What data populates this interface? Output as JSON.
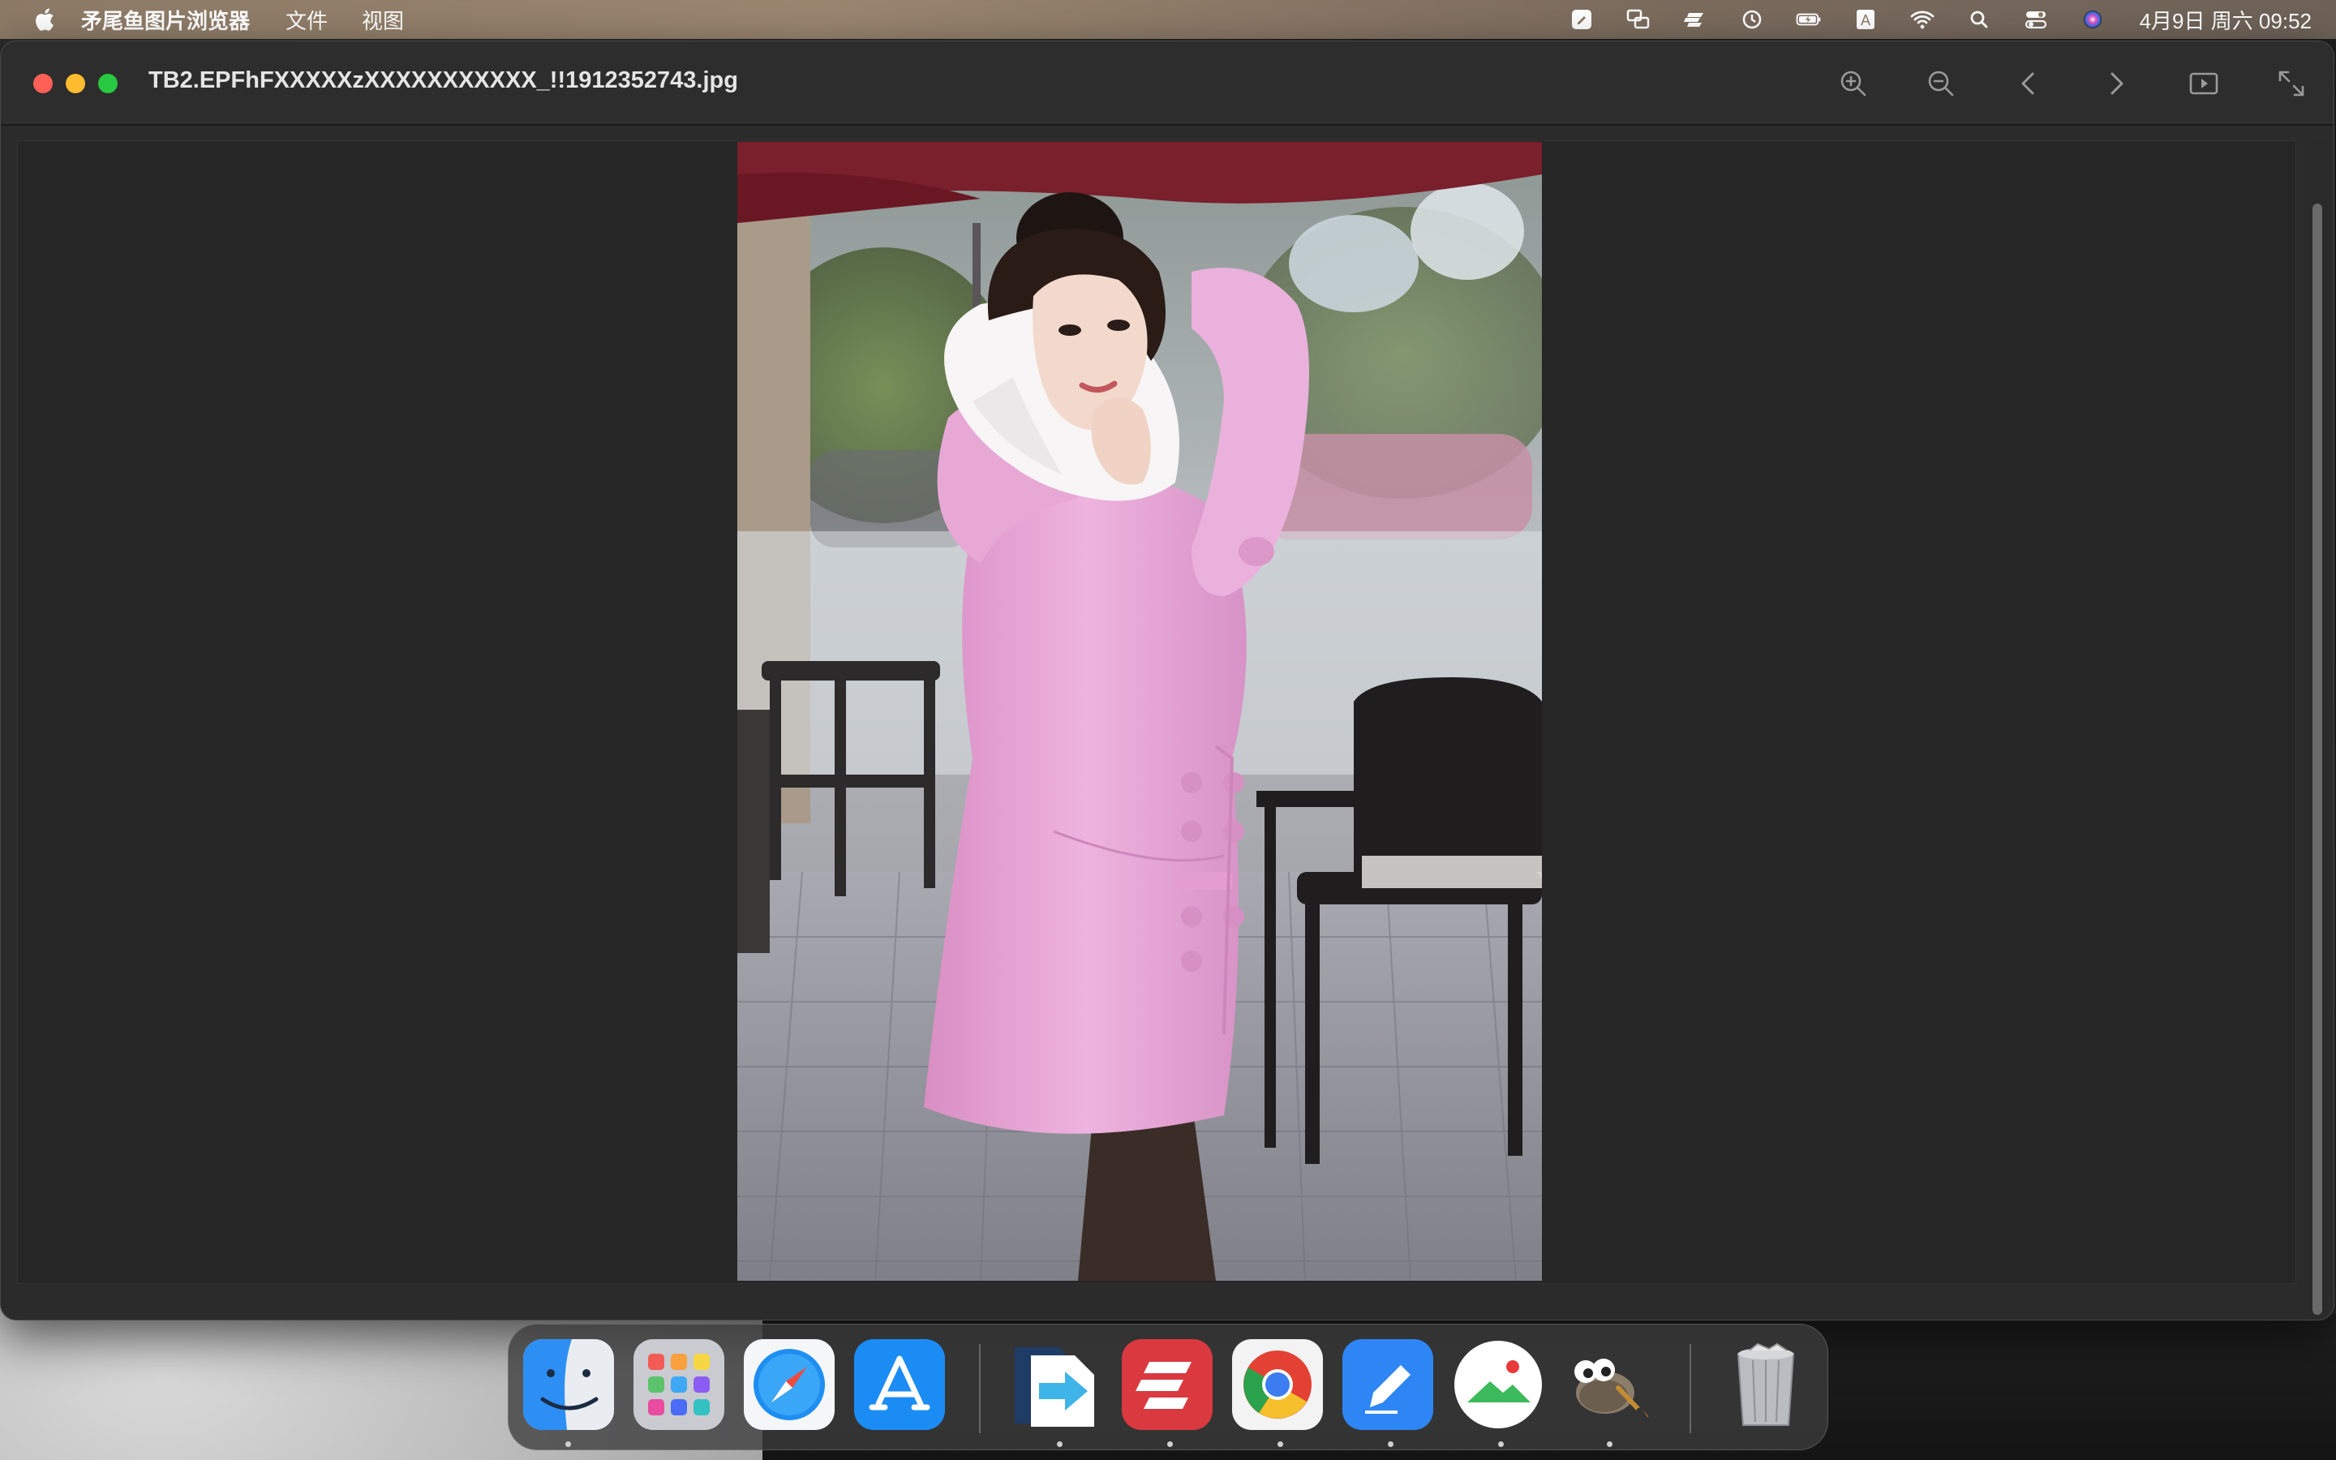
{
  "menubar": {
    "app_name": "矛尾鱼图片浏览器",
    "menus": [
      "文件",
      "视图"
    ],
    "status_icons": [
      "note-icon",
      "screen-mirror-icon",
      "expressvpn-icon",
      "time-machine-icon",
      "battery-icon",
      "input-method-icon",
      "wifi-icon",
      "spotlight-search-icon",
      "control-center-icon",
      "siri-icon"
    ],
    "input_method_label": "A",
    "clock": "4月9日 周六  09:52"
  },
  "window": {
    "title": "TB2.EPFhFXXXXXzXXXXXXXXXXX_!!1912352743.jpg",
    "toolbar": [
      "zoom-in-icon",
      "zoom-out-icon",
      "previous-icon",
      "next-icon",
      "slideshow-icon",
      "fullscreen-icon"
    ]
  },
  "photo": {
    "description_icon": "photo-woman-pink-coat",
    "colors": {
      "coat": "#e9a9d6",
      "umbrella": "#7a1f2c",
      "ground": "#8d8e96"
    }
  },
  "dock": {
    "apps": [
      "finder-icon",
      "launchpad-icon",
      "safari-icon",
      "app-store-icon",
      "migrate-icon",
      "expressvpn-icon",
      "chrome-icon",
      "pages-icon",
      "preview-icon",
      "gimp-icon",
      "trash-icon"
    ]
  },
  "colors": {
    "close": "#fe5f57",
    "minimize": "#febc2e",
    "maximize": "#28c840",
    "window_bg": "#2b2b2b"
  }
}
